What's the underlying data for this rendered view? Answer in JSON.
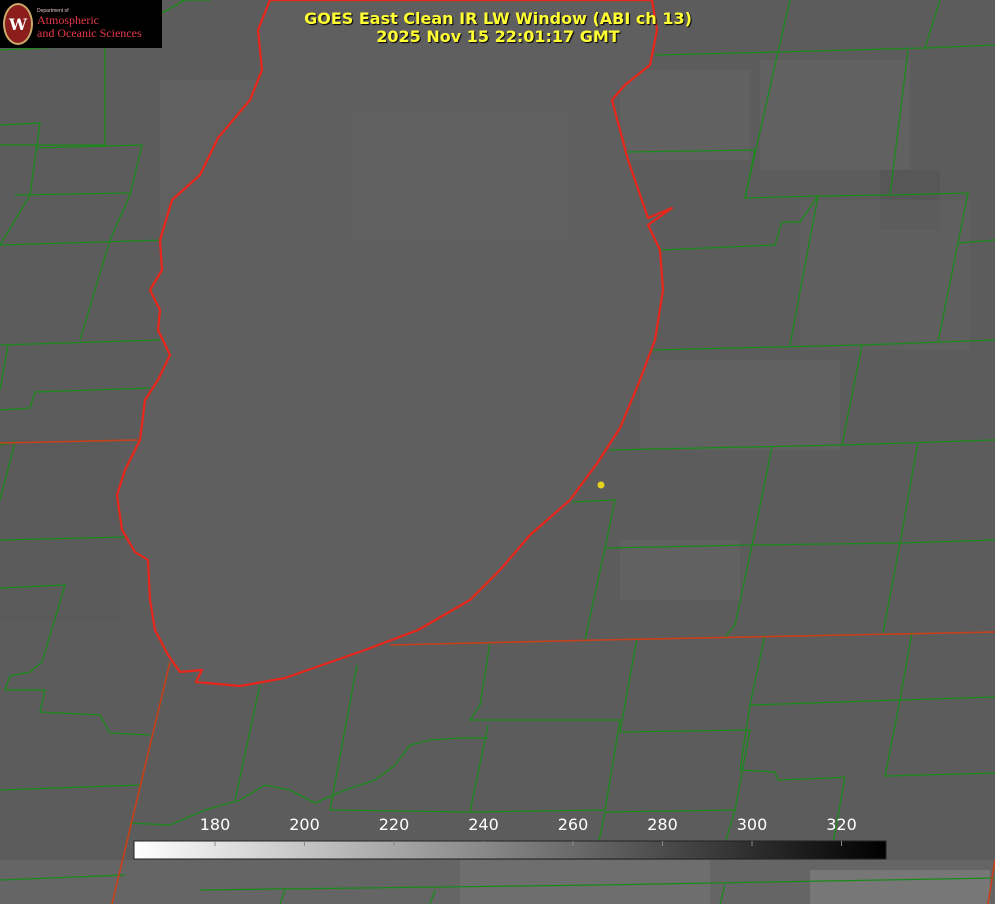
{
  "logo": {
    "department": "Department of",
    "name_line1": "Atmospheric",
    "name_line2": "and Oceanic Sciences",
    "seal_letter": "W"
  },
  "title": {
    "line1": "GOES East Clean IR LW Window (ABI ch 13)",
    "line2": "2025 Nov 15 22:01:17 GMT"
  },
  "colorbar": {
    "ticks": [
      "180",
      "200",
      "220",
      "240",
      "260",
      "280",
      "300",
      "320"
    ],
    "scale_start_color": "#ffffff",
    "scale_end_color": "#000000"
  },
  "colors": {
    "background_gray": "#5c5c5c",
    "lake_fill": "#5f5f5f",
    "shoreline": "#e8261a",
    "boundaries": "#1a8a1a",
    "state_line": "#c8401a",
    "title_text": "#ffff33",
    "marker": "#e6d21e"
  },
  "icons": {
    "logo_seal": "university-seal-icon",
    "location_marker": "dot-marker-icon"
  }
}
